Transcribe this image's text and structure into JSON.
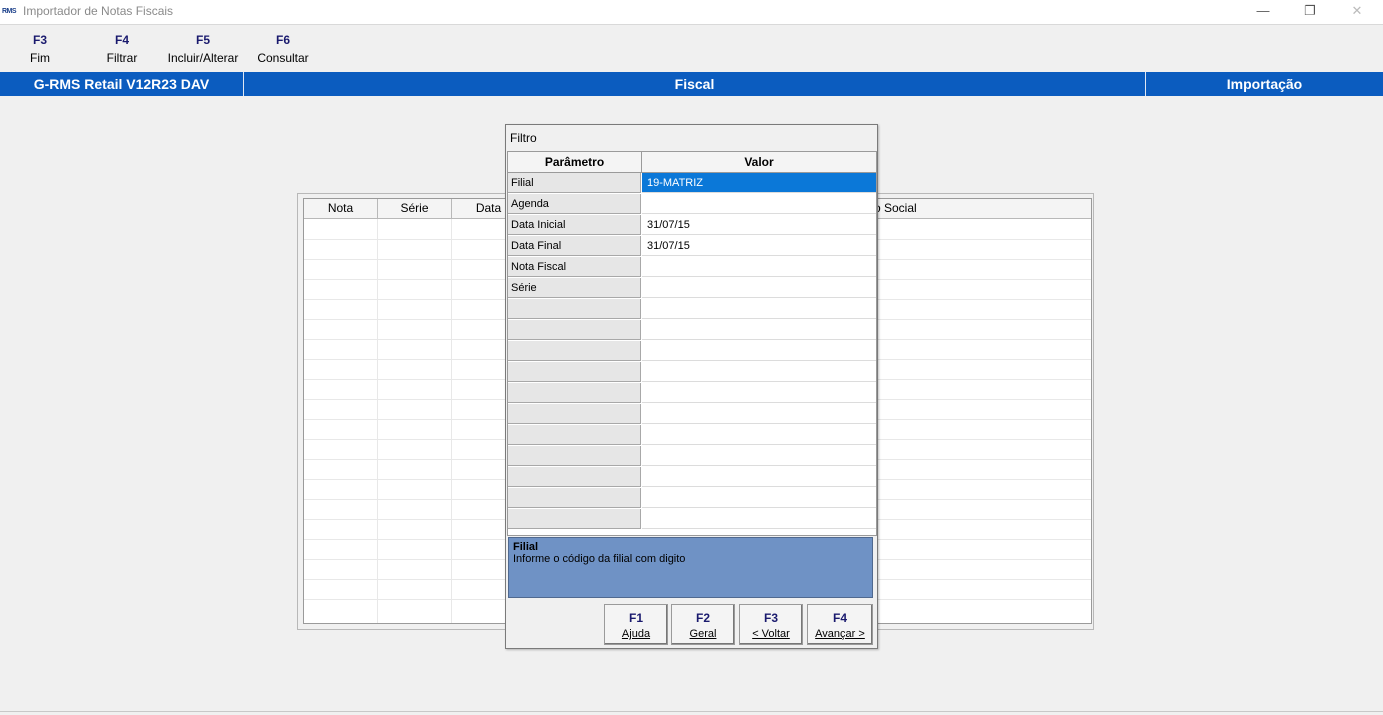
{
  "window": {
    "logo_text": "RMS",
    "title": "Importador de Notas Fiscais",
    "minimize": "—",
    "maximize": "❐",
    "close": "✕"
  },
  "toolbar": [
    {
      "key": "F3",
      "label": "Fim"
    },
    {
      "key": "F4",
      "label": "Filtrar"
    },
    {
      "key": "F5",
      "label": "Incluir/Alterar"
    },
    {
      "key": "F6",
      "label": "Consultar"
    }
  ],
  "header": {
    "product": "G-RMS Retail V12R23 DAV",
    "module": "Fiscal",
    "function": "Importação"
  },
  "background_grid": {
    "columns": [
      "Nota",
      "Série",
      "Data",
      "o Social"
    ]
  },
  "dialog": {
    "title": "Filtro",
    "col_param": "Parâmetro",
    "col_value": "Valor",
    "rows": [
      {
        "param": "Filial",
        "value": "19-MATRIZ"
      },
      {
        "param": "Agenda",
        "value": ""
      },
      {
        "param": "Data Inicial",
        "value": "31/07/15"
      },
      {
        "param": "Data Final",
        "value": "31/07/15"
      },
      {
        "param": "Nota Fiscal",
        "value": ""
      },
      {
        "param": "Série",
        "value": ""
      }
    ],
    "help": {
      "title": "Filial",
      "text": "Informe o código da filial com digito"
    },
    "buttons": [
      {
        "key": "F1",
        "label": "Ajuda"
      },
      {
        "key": "F2",
        "label": "Geral"
      },
      {
        "key": "F3",
        "label": "< Voltar"
      },
      {
        "key": "F4",
        "label": "Avançar >"
      }
    ]
  }
}
